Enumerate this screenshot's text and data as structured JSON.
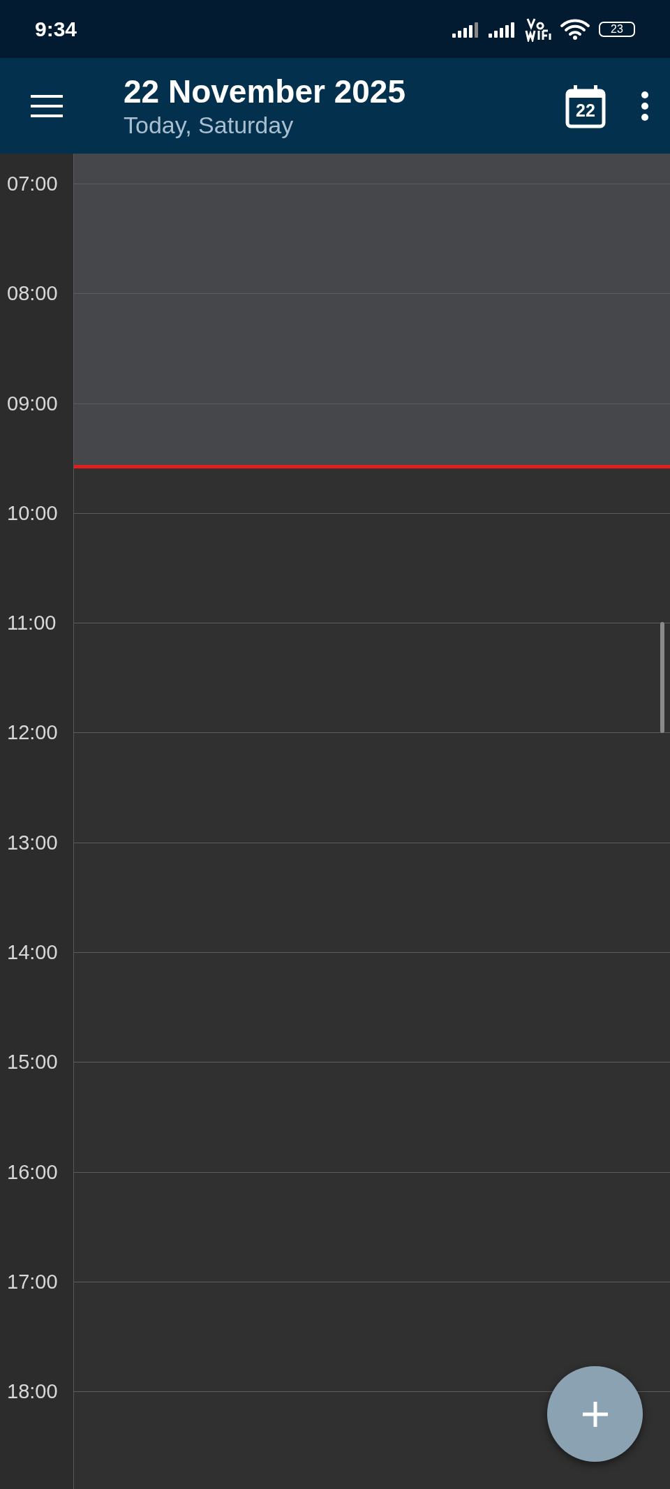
{
  "status_bar": {
    "time": "9:34",
    "battery": "23"
  },
  "app_bar": {
    "title": "22 November 2025",
    "subtitle": "Today, Saturday",
    "calendar_day": "22"
  },
  "day_view": {
    "past": {
      "level": 0.234
    },
    "hours": [
      "07:00",
      "08:00",
      "09:00",
      "10:00",
      "11:00",
      "12:00",
      "13:00",
      "14:00",
      "15:00",
      "16:00",
      "17:00",
      "18:00"
    ]
  }
}
